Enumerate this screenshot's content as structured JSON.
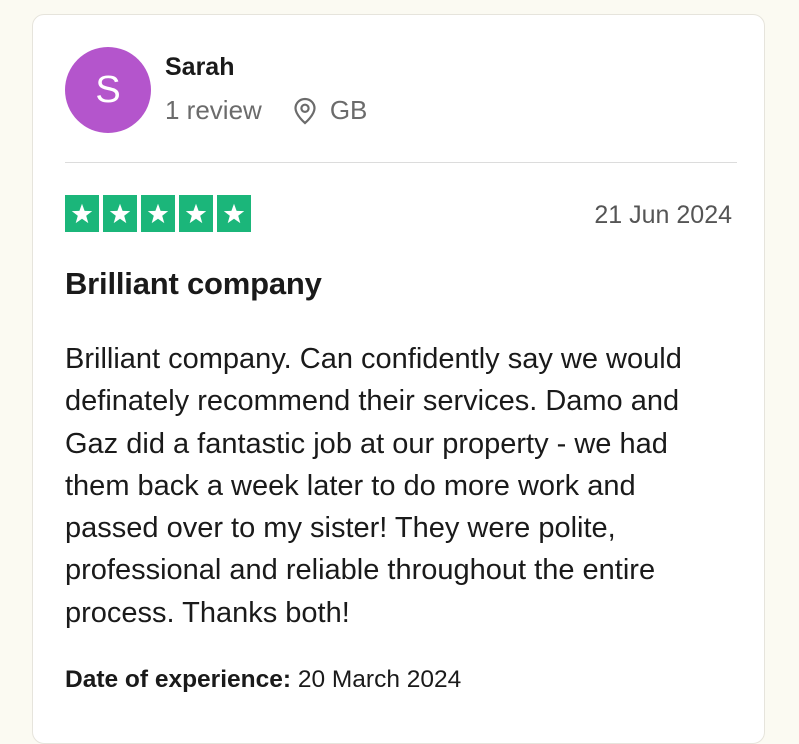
{
  "reviewer": {
    "initial": "S",
    "name": "Sarah",
    "review_count": "1 review",
    "location": "GB",
    "avatar_color": "#b455cc",
    "location_icon": "location-pin-icon"
  },
  "review": {
    "rating": 5,
    "max_rating": 5,
    "star_color": "#1bb67a",
    "date": "21 Jun 2024",
    "title": "Brilliant company",
    "body": "Brilliant company. Can confidently say we would definately recommend their services. Damo and Gaz did a fantastic job at our property - we had them back a week later to do more work and passed over to my sister! They were polite, professional and reliable throughout the entire process. Thanks both!",
    "experience_label": "Date of experience:",
    "experience_date": "20 March 2024"
  }
}
